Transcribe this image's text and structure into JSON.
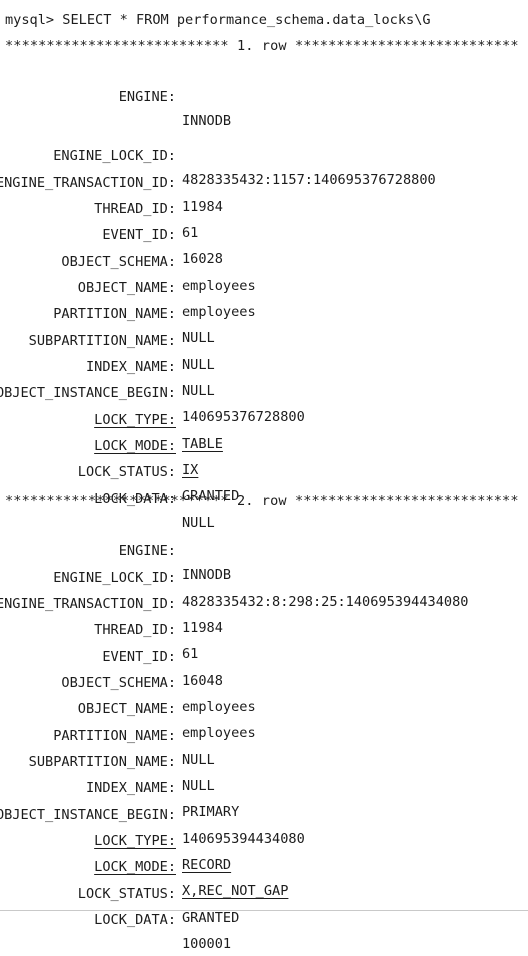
{
  "terminal": {
    "command": "mysql> SELECT * FROM performance_schema.data_locks\\G",
    "rows": [
      {
        "separator": "*************************** 1. row ***************************",
        "fields": [
          {
            "key": "ENGINE:",
            "value": "INNODB"
          },
          {
            "key": "ENGINE_LOCK_ID:",
            "value": "4828335432:1157:140695376728800"
          },
          {
            "key": "ENGINE_TRANSACTION_ID:",
            "value": "11984"
          },
          {
            "key": "THREAD_ID:",
            "value": "61"
          },
          {
            "key": "EVENT_ID:",
            "value": "16028"
          },
          {
            "key": "OBJECT_SCHEMA:",
            "value": "employees"
          },
          {
            "key": "OBJECT_NAME:",
            "value": "employees"
          },
          {
            "key": "PARTITION_NAME:",
            "value": "NULL"
          },
          {
            "key": "SUBPARTITION_NAME:",
            "value": "NULL"
          },
          {
            "key": "INDEX_NAME:",
            "value": "NULL"
          },
          {
            "key": "OBJECT_INSTANCE_BEGIN:",
            "value": "140695376728800"
          },
          {
            "key": "LOCK_TYPE:",
            "value": "TABLE"
          },
          {
            "key": "LOCK_MODE:",
            "value": "IX"
          },
          {
            "key": "LOCK_STATUS:",
            "value": "GRANTED"
          },
          {
            "key": "LOCK_DATA:",
            "value": "NULL"
          }
        ]
      },
      {
        "separator": "*************************** 2. row ***************************",
        "fields": [
          {
            "key": "ENGINE:",
            "value": "INNODB"
          },
          {
            "key": "ENGINE_LOCK_ID:",
            "value": "4828335432:8:298:25:140695394434080"
          },
          {
            "key": "ENGINE_TRANSACTION_ID:",
            "value": "11984"
          },
          {
            "key": "THREAD_ID:",
            "value": "61"
          },
          {
            "key": "EVENT_ID:",
            "value": "16048"
          },
          {
            "key": "OBJECT_SCHEMA:",
            "value": "employees"
          },
          {
            "key": "OBJECT_NAME:",
            "value": "employees"
          },
          {
            "key": "PARTITION_NAME:",
            "value": "NULL"
          },
          {
            "key": "SUBPARTITION_NAME:",
            "value": "NULL"
          },
          {
            "key": "INDEX_NAME:",
            "value": "PRIMARY"
          },
          {
            "key": "OBJECT_INSTANCE_BEGIN:",
            "value": "140695394434080"
          },
          {
            "key": "LOCK_TYPE:",
            "value": "RECORD"
          },
          {
            "key": "LOCK_MODE:",
            "value": "X,REC_NOT_GAP"
          },
          {
            "key": "LOCK_STATUS:",
            "value": "GRANTED"
          },
          {
            "key": "LOCK_DATA:",
            "value": "100001"
          }
        ]
      }
    ]
  }
}
